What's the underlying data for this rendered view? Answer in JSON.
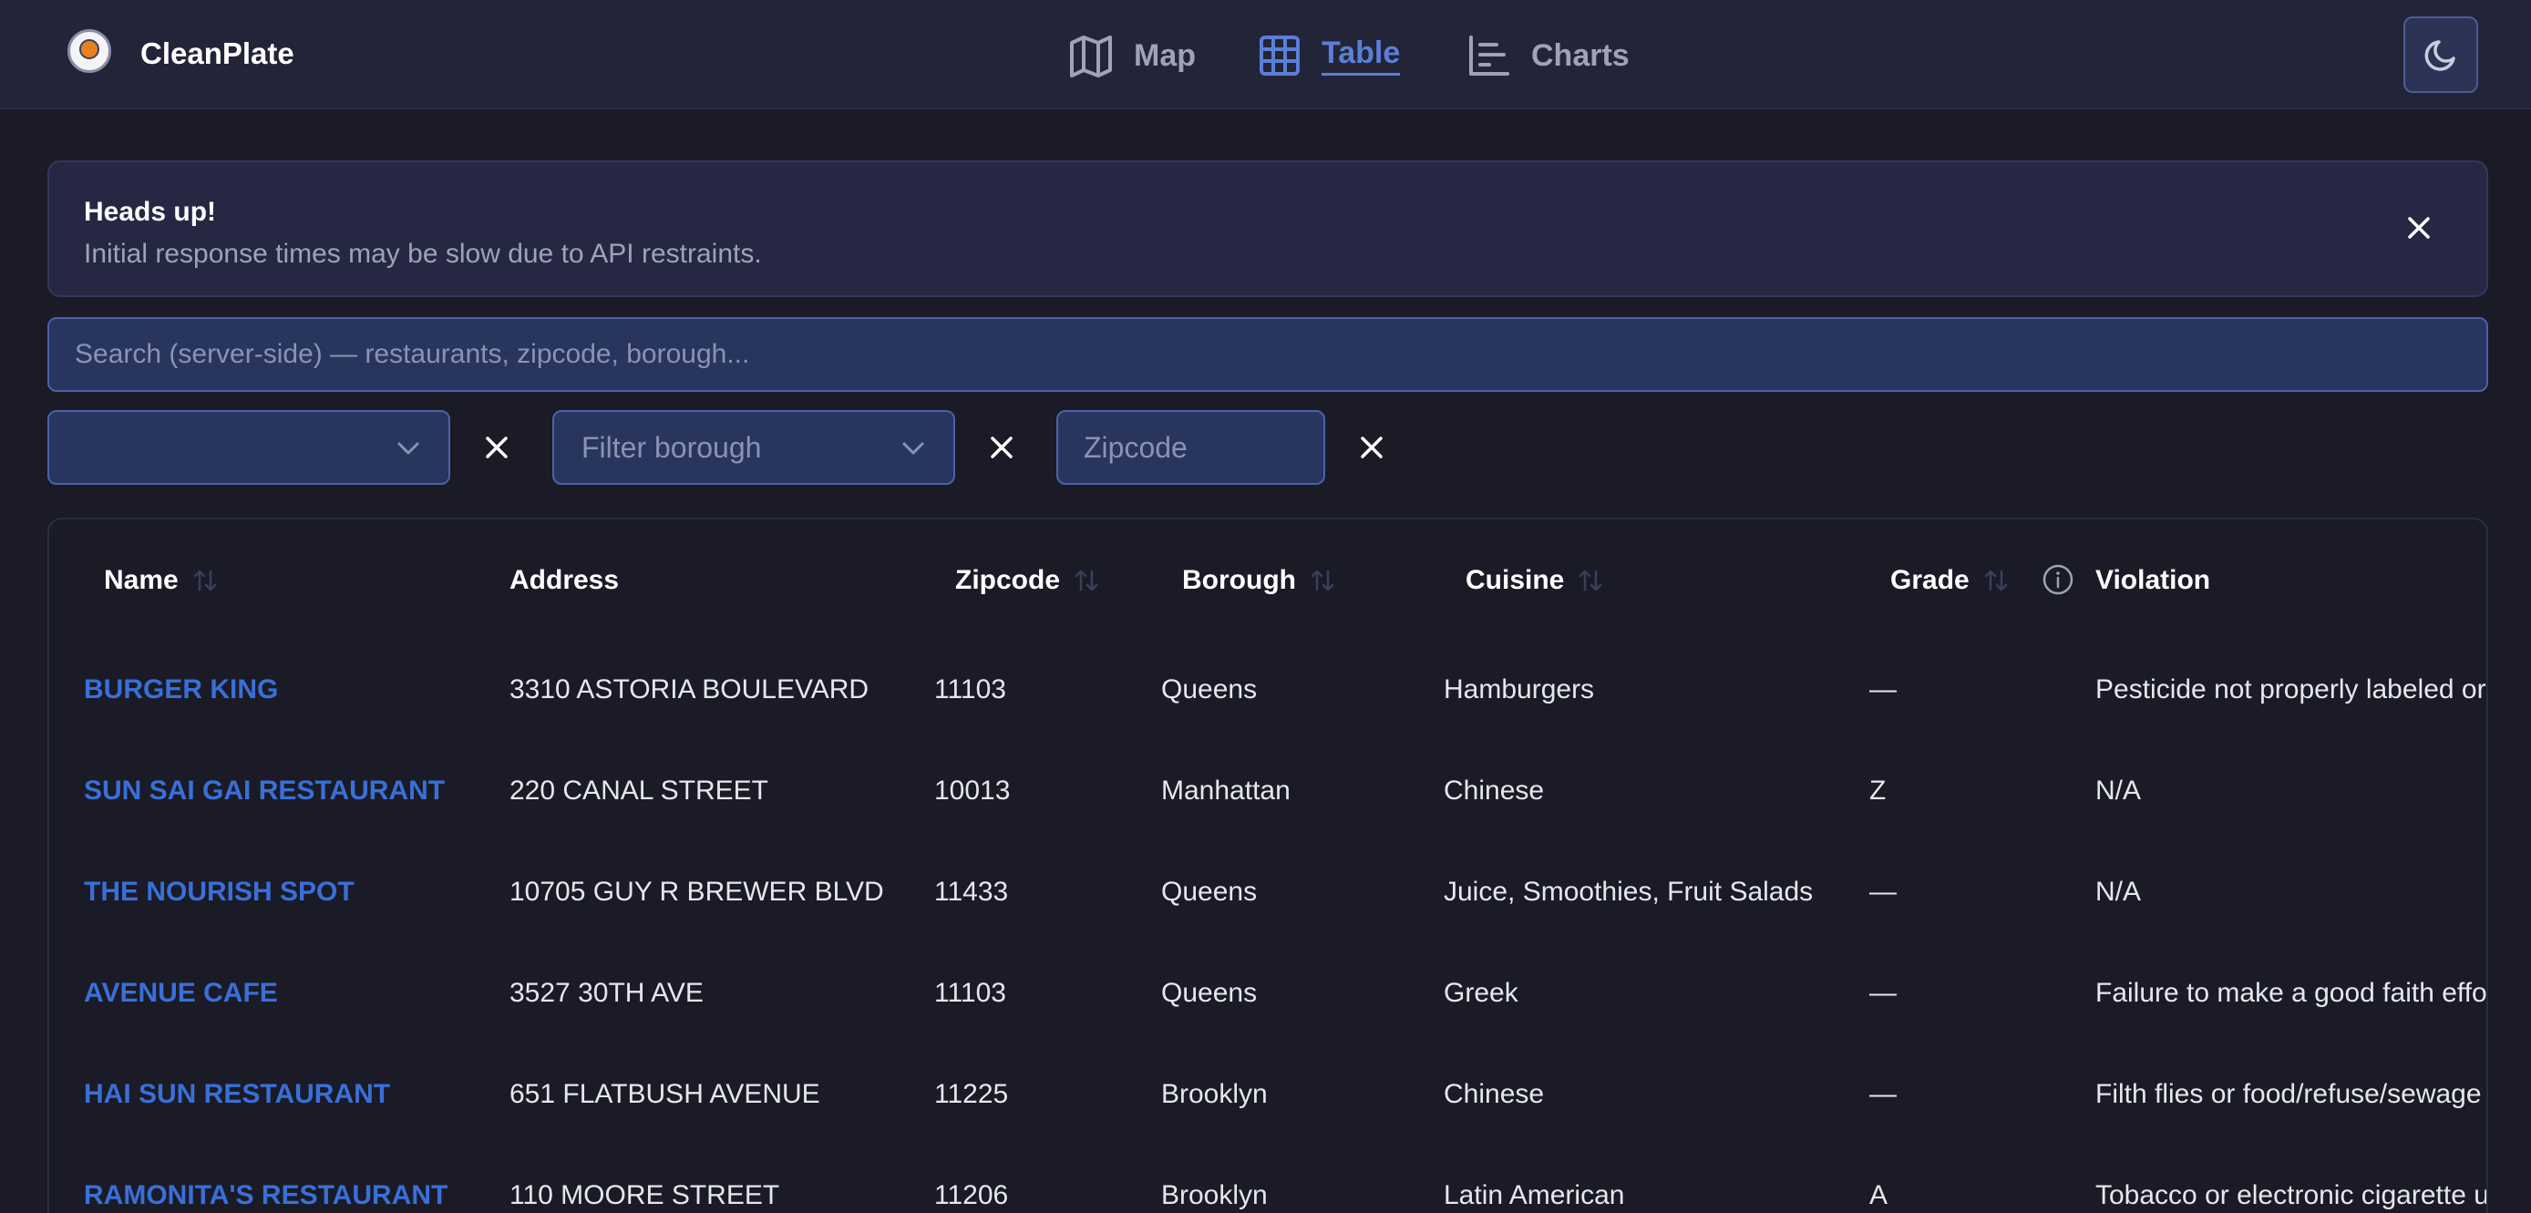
{
  "app": {
    "brand": "CleanPlate"
  },
  "nav": [
    {
      "label": "Map",
      "icon": "map-icon"
    },
    {
      "label": "Table",
      "icon": "table-icon",
      "active": true
    },
    {
      "label": "Charts",
      "icon": "chart-icon"
    }
  ],
  "theme_toggle": {
    "icon": "moon-icon"
  },
  "alert": {
    "title": "Heads up!",
    "message": "Initial response times may be slow due to API restraints."
  },
  "search": {
    "placeholder": "Search (server-side) — restaurants, zipcode, borough...",
    "value": ""
  },
  "filters": {
    "first_select_value": "",
    "borough_placeholder": "Filter borough",
    "zipcode_placeholder": "Zipcode"
  },
  "table": {
    "headers": [
      "Name",
      "Address",
      "Zipcode",
      "Borough",
      "Cuisine",
      "Grade",
      "Violation"
    ],
    "rows": [
      [
        "BURGER KING",
        "3310 ASTORIA BOULEVARD",
        "11103",
        "Queens",
        "Hamburgers",
        "—",
        "Pesticide not properly labeled or us"
      ],
      [
        "SUN SAI GAI RESTAURANT",
        "220 CANAL STREET",
        "10013",
        "Manhattan",
        "Chinese",
        "Z",
        "N/A"
      ],
      [
        "THE NOURISH SPOT",
        "10705 GUY R BREWER BLVD",
        "11433",
        "Queens",
        "Juice, Smoothies, Fruit Salads",
        "—",
        "N/A"
      ],
      [
        "AVENUE CAFE",
        "3527 30TH AVE",
        "11103",
        "Queens",
        "Greek",
        "—",
        "Failure to make a good faith effort"
      ],
      [
        "HAI SUN RESTAURANT",
        "651 FLATBUSH AVENUE",
        "11225",
        "Brooklyn",
        "Chinese",
        "—",
        "Filth flies or food/refuse/sewage a"
      ],
      [
        "RAMONITA'S RESTAURANT",
        "110 MOORE STREET",
        "11206",
        "Brooklyn",
        "Latin American",
        "A",
        "Tobacco or electronic cigarette use"
      ]
    ]
  },
  "colors": {
    "background": "#1a1b26",
    "header": "#232438",
    "accent": "#5b7fd6",
    "link": "#3a6fd8",
    "input_bg": "#28355e"
  }
}
